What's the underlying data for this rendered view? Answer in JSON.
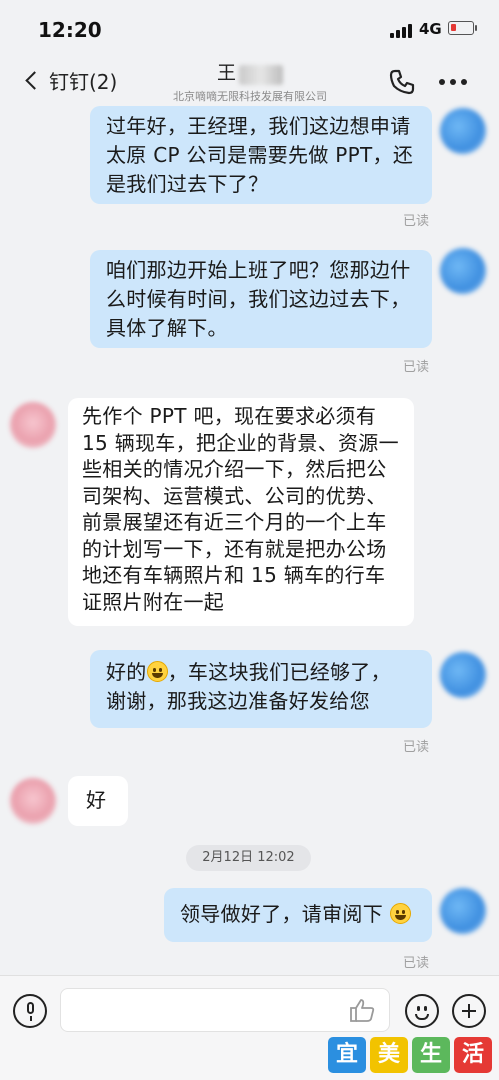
{
  "status_bar": {
    "time": "12:20",
    "network": "4G"
  },
  "nav": {
    "back_label": "钉钉(2)",
    "contact_name": "王",
    "org_name": "北京嘀嘀无限科技发展有限公司"
  },
  "messages": [
    {
      "from": "me",
      "lines": [
        "过年好，王经理，我们这边想申请",
        "太原 CP 公司是需要先做 PPT，还",
        "是我们过去下了？"
      ],
      "read_label": "已读"
    },
    {
      "from": "me",
      "lines": [
        "咱们那边开始上班了吧？您那边什",
        "么时候有时间，我们这边过去下，",
        "具体了解下。"
      ],
      "read_label": "已读"
    },
    {
      "from": "them",
      "lines": [
        "先作个 PPT 吧，现在要求必须有",
        "15 辆现车，把企业的背景、资源一",
        "些相关的情况介绍一下，然后把公",
        "司架构、运营模式、公司的优势、",
        "前景展望还有近三个月的一个上车",
        "的计划写一下，还有就是把办公场",
        "地还有车辆照片和 15 辆车的行车",
        "证照片附在一起"
      ]
    },
    {
      "from": "me",
      "line1_before_emoji": "好的",
      "line1_after_emoji": "，车这块我们已经够了，",
      "line2": "谢谢，那我这边准备好发给您",
      "read_label": "已读"
    },
    {
      "from": "them",
      "text": "好"
    },
    {
      "from": "me",
      "text": "领导做好了，请审阅下",
      "read_label": "已读"
    }
  ],
  "timestamp_chip": "2月12日 12:02",
  "input": {
    "placeholder": ""
  },
  "icons": {
    "back": "chevron-left-icon",
    "call": "phone-icon",
    "more": "more-dots-icon",
    "mic": "microphone-icon",
    "like": "thumbs-up-icon",
    "emoji": "smiley-icon",
    "plus": "plus-circle-icon"
  },
  "watermark": {
    "chars": [
      "宜",
      "美",
      "生",
      "活"
    ],
    "colors": [
      "#2b8fe0",
      "#f2c300",
      "#5cb85c",
      "#e53935"
    ]
  }
}
